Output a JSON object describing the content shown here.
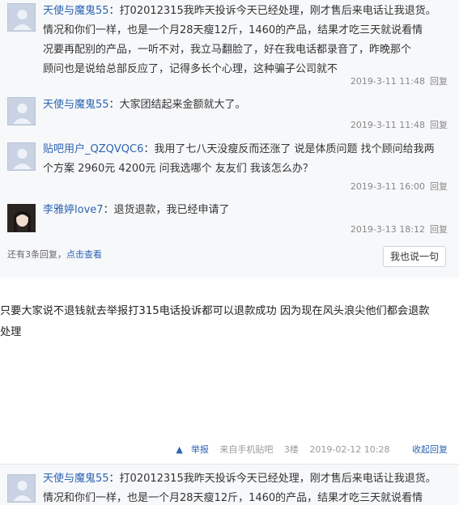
{
  "thread": {
    "replies": [
      {
        "user": "天使与魔鬼55",
        "line1": "：打02012315我昨天投诉今天已经处理，刚才售后来电话让我退货。",
        "line2": "情况和你们一样，也是一个月28天瘦12斤，1460的产品，结果才吃三天就说看情",
        "line3": "况要再配别的产品，一听不对，我立马翻脸了，好在我电话都录音了，昨晚那个",
        "line4": "顾问也是说给总部反应了，记得多长个心理，这种骗子公司就不",
        "time": "2019-3-11 11:48",
        "reply_label": "回复"
      },
      {
        "user": "天使与魔鬼55",
        "line1": "：大家团结起来金额就大了。",
        "time": "2019-3-11 11:48",
        "reply_label": "回复"
      },
      {
        "user": "贴吧用户_QZQVQC6",
        "line1": "：我用了七八天没瘦反而还涨了 说是体质问题 找个顾问给我两",
        "line2": "个方案 2960元 4200元 问我选哪个 友友们 我该怎么办？",
        "time": "2019-3-11 16:00",
        "reply_label": "回复"
      },
      {
        "user": "李雅婷love7",
        "line1": "：退货退款，我已经申请了",
        "time": "2019-3-13 18:12",
        "reply_label": "回复"
      }
    ],
    "more": {
      "prefix": "还有3条回复，",
      "link": "点击查看"
    },
    "say_button": "我也说一句"
  },
  "post": {
    "line1": "只要大家说不退钱就去举报打315电话投诉都可以退款成功 因为现在风头浪尖他们都会退款",
    "line2": "处理",
    "report": "举报",
    "source": "来自手机贴吧",
    "floor": "3楼",
    "time": "2019-02-12 10:28",
    "collapse": "收起回复"
  },
  "bottom_reply": {
    "user": "天使与魔鬼55",
    "line1": "：打02012315我昨天投诉今天已经处理，刚才售后来电话让我退货。",
    "line2": "情况和你们一样，也是一个月28天瘦12斤，1460的产品，结果才吃三天就说看情"
  }
}
